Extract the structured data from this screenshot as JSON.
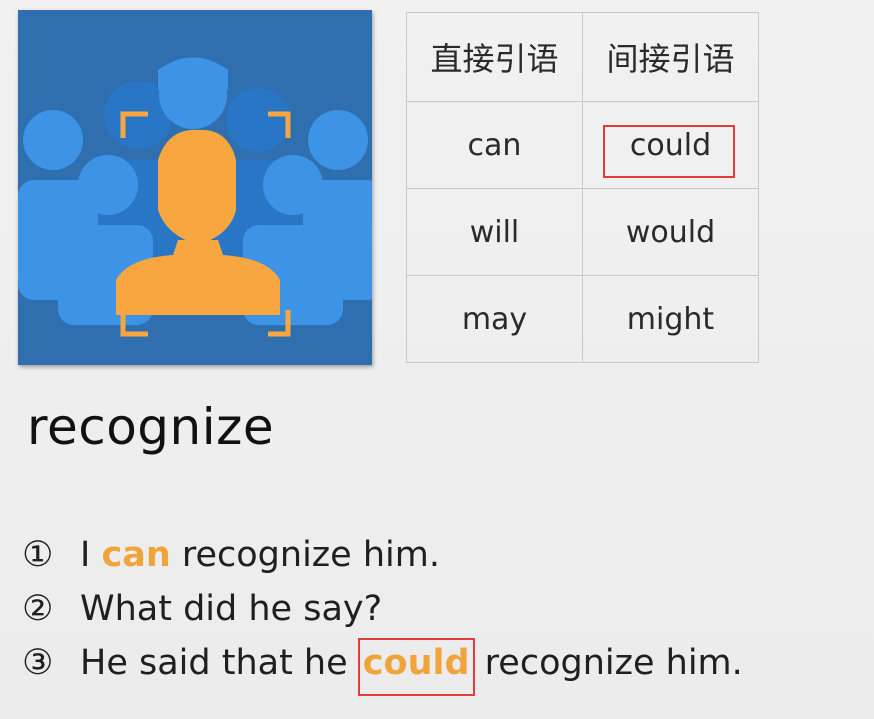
{
  "table": {
    "headers": [
      "直接引语",
      "间接引语"
    ],
    "rows": [
      [
        "can",
        "could"
      ],
      [
        "will",
        "would"
      ],
      [
        "may",
        "might"
      ]
    ]
  },
  "word": "recognize",
  "sentences": [
    {
      "num": "①",
      "before": "I ",
      "highlight": "can",
      "after": " recognize him."
    },
    {
      "num": "②",
      "text": "What did he say?"
    },
    {
      "num": "③",
      "before": "He said that he ",
      "highlight": "could",
      "after": " recognize him."
    }
  ],
  "colors": {
    "accent_orange": "#f0a53c",
    "highlight_box": "#e23b3b",
    "illustration_bg": "#2f6fb0",
    "person_blue": "#3d94e6"
  },
  "icons": {
    "illustration": "face-recognition-crowd-icon"
  }
}
